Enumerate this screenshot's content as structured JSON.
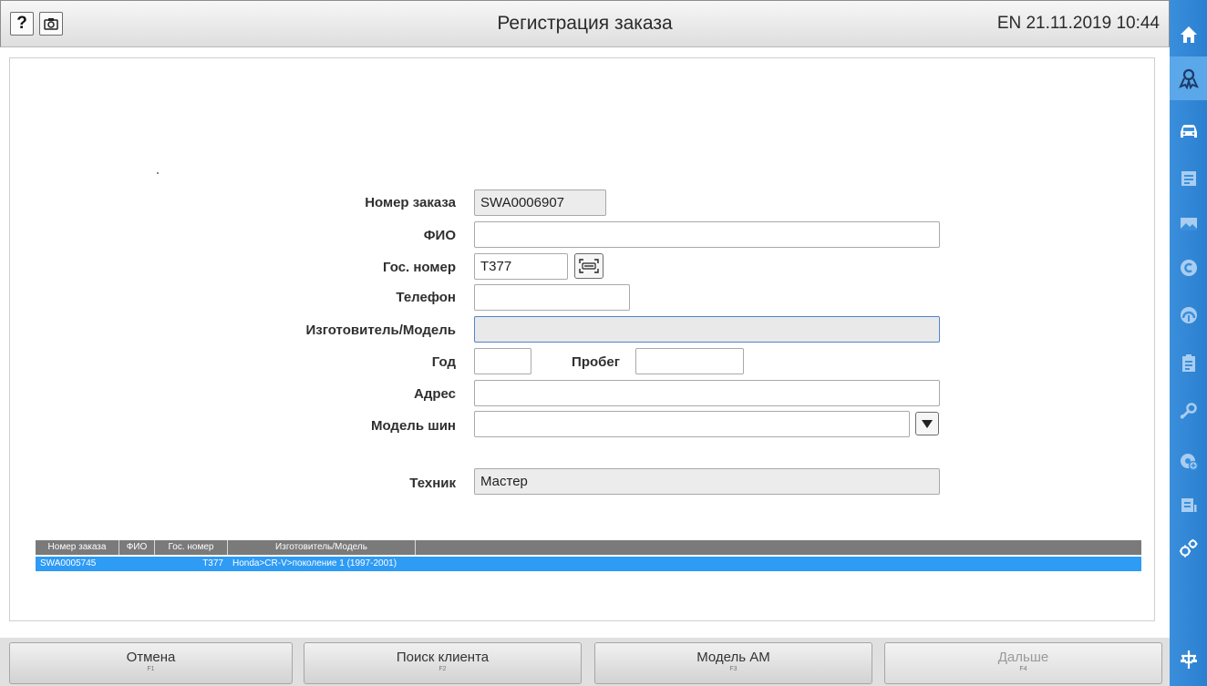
{
  "app": {
    "title": "Регистрация заказа",
    "status": "EN 21.11.2019 10:44"
  },
  "toolbar": {
    "help_label": "?"
  },
  "form": {
    "order_number": {
      "label": "Номер заказа",
      "value": "SWA0006907"
    },
    "full_name": {
      "label": "ФИО",
      "value": ""
    },
    "plate": {
      "label": "Гос. номер",
      "value": "T377"
    },
    "phone": {
      "label": "Телефон",
      "value": ""
    },
    "make_model": {
      "label": "Изготовитель/Модель",
      "value": ""
    },
    "year": {
      "label": "Год",
      "value": ""
    },
    "mileage": {
      "label": "Пробег",
      "value": ""
    },
    "address": {
      "label": "Адрес",
      "value": ""
    },
    "tire_model": {
      "label": "Модель шин",
      "value": ""
    },
    "technician": {
      "label": "Техник",
      "value": "Мастер"
    }
  },
  "results_table": {
    "columns": [
      "Номер заказа",
      "ФИО",
      "Гос. номер",
      "Изготовитель/Модель"
    ],
    "rows": [
      {
        "order": "SWA0005745",
        "name": "",
        "plate": "T377",
        "model": "Honda>CR-V>поколение 1 (1997-2001)"
      }
    ]
  },
  "bottom_buttons": [
    {
      "label": "Отмена",
      "key": "F1",
      "enabled": true
    },
    {
      "label": "Поиск клиента",
      "key": "F2",
      "enabled": true
    },
    {
      "label": "Модель AM",
      "key": "F3",
      "enabled": true
    },
    {
      "label": "Дальше",
      "key": "F4",
      "enabled": false
    }
  ],
  "sidebar": {
    "items": [
      "home-icon",
      "customer-icon",
      "car-icon",
      "document-icon",
      "image-icon",
      "c-circle-icon",
      "gauge-icon",
      "checklist-icon",
      "wrench-icon",
      "tire-add-icon",
      "report-icon",
      "settings-icon",
      "network-icon"
    ],
    "active": "customer-icon"
  },
  "colors": {
    "sidebar": "#3a8fdc",
    "sidebar_active": "#5aa7ea",
    "table_selected": "#2e9bf5",
    "table_header": "#7a7a7a",
    "focus_border": "#4f86c6"
  }
}
